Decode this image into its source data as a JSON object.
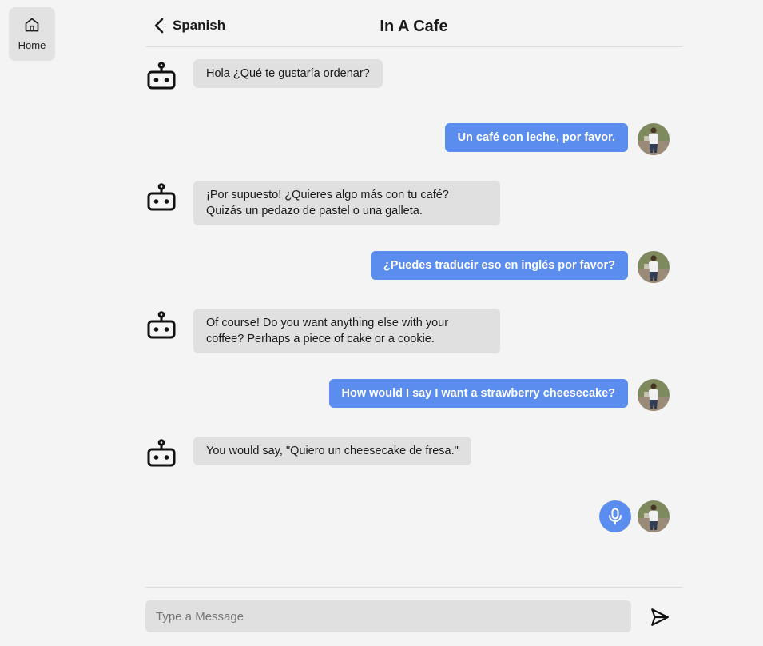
{
  "nav": {
    "home_label": "Home",
    "home_icon": "home-icon"
  },
  "header": {
    "back_label": "Spanish",
    "title": "In A Cafe"
  },
  "messages": [
    {
      "role": "bot",
      "lines": [
        "Hola ¿Qué te gustaría ordenar?"
      ]
    },
    {
      "role": "user",
      "lines": [
        "Un café con leche, por favor."
      ]
    },
    {
      "role": "bot",
      "lines": [
        "¡Por supuesto! ¿Quieres algo más con tu café?",
        "Quizás un pedazo de pastel o una galleta."
      ]
    },
    {
      "role": "user",
      "lines": [
        "¿Puedes traducir eso en inglés por favor?"
      ]
    },
    {
      "role": "bot",
      "lines": [
        "Of course! Do you want anything else with your",
        "coffee? Perhaps a piece of cake or a cookie."
      ]
    },
    {
      "role": "user",
      "lines": [
        "How would I say I want a strawberry cheesecake?"
      ]
    },
    {
      "role": "bot",
      "lines": [
        "You would say, \"Quiero un cheesecake de fresa.\""
      ]
    }
  ],
  "composer": {
    "placeholder": "Type a Message",
    "value": ""
  },
  "icons": {
    "bot": "robot-icon",
    "mic": "microphone-icon",
    "send": "send-icon",
    "back": "chevron-left-icon"
  },
  "colors": {
    "accent": "#5b8def",
    "bot_bubble": "#e0e0e0",
    "background": "#f4f4f4"
  }
}
